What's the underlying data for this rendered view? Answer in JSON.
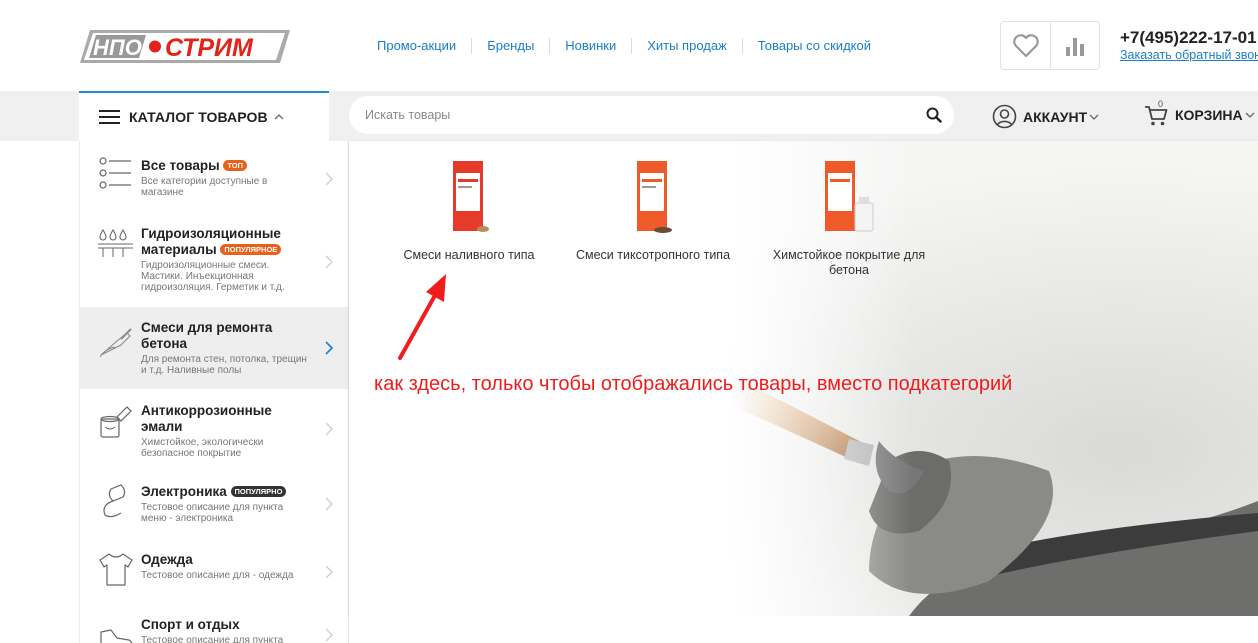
{
  "header": {
    "logo_text": "НПО СТРИМ",
    "nav": [
      "Промо-акции",
      "Бренды",
      "Новинки",
      "Хиты продаж",
      "Товары со скидкой"
    ],
    "phone": "+7(495)222-17-01",
    "callback": "Заказать обратный звонок",
    "wishlist_icon": "heart-icon",
    "compare_icon": "bar-chart-icon"
  },
  "toolbar": {
    "catalog_label": "КАТАЛОГ ТОВАРОВ",
    "search_placeholder": "Искать товары",
    "account_label": "АККАУНТ",
    "cart_label": "КОРЗИНА",
    "cart_count": "0"
  },
  "sidebar": {
    "items": [
      {
        "title": "Все товары",
        "badge": "топ",
        "desc": "Все категории доступные в магазине",
        "icon": "list-icon"
      },
      {
        "title": "Гидроизоляционные материалы",
        "badge": "популярное",
        "desc": "Гидроизоляционные смеси. Мастики. Инъекционная гидроизоляция. Герметик и т.д.",
        "icon": "drops-icon"
      },
      {
        "title": "Смеси для ремонта бетона",
        "badge": "",
        "desc": "Для ремонта стен, потолка, трещин и т.д. Наливные полы",
        "icon": "trowel-icon"
      },
      {
        "title": "Антикоррозионные эмали",
        "badge": "",
        "desc": "Химстойкое, экологически безопасное покрытие",
        "icon": "paint-icon"
      },
      {
        "title": "Электроника",
        "badge": "популярно",
        "desc": "Тестовое описание для пункта меню - электроника",
        "icon": "mouse-icon"
      },
      {
        "title": "Одежда",
        "badge": "",
        "desc": "Тестовое описание для - одежда",
        "icon": "shirt-icon"
      },
      {
        "title": "Спорт и отдых",
        "badge": "",
        "desc": "Тестовое описание для пункта",
        "icon": "sneaker-icon"
      }
    ]
  },
  "panel": {
    "categories": [
      {
        "label": "Смеси наливного типа"
      },
      {
        "label": "Смеси тиксотропного типа"
      },
      {
        "label": "Химстойкое покрытие для бетона"
      }
    ],
    "annotation": "как здесь, только чтобы отображались товары, вместо подкатегорий"
  },
  "colors": {
    "accent": "#1a7fc9",
    "badge_orange": "#e8611a",
    "annotation": "#f01d1d",
    "logo_red": "#e2231a"
  }
}
